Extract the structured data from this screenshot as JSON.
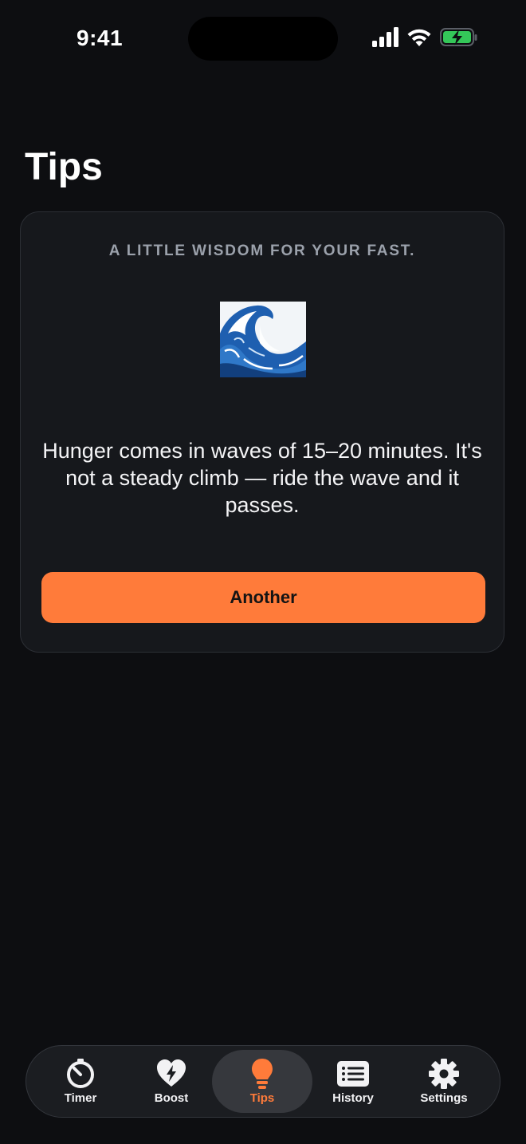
{
  "status_bar": {
    "time": "9:41",
    "icons": [
      "cellular-signal-icon",
      "wifi-icon",
      "battery-charging-icon"
    ],
    "battery_color": "#34c759"
  },
  "page": {
    "title": "Tips"
  },
  "card": {
    "eyebrow": "A LITTLE WISDOM FOR YOUR FAST.",
    "emoji": "wave-emoji",
    "tip": "Hunger comes in waves of 15–20 minutes. It's not a steady climb — ride the wave and it passes.",
    "button_label": "Another"
  },
  "tab_bar": {
    "items": [
      {
        "label": "Timer",
        "icon": "stopwatch-icon",
        "active": false
      },
      {
        "label": "Boost",
        "icon": "heart-bolt-icon",
        "active": false
      },
      {
        "label": "Tips",
        "icon": "lightbulb-icon",
        "active": true
      },
      {
        "label": "History",
        "icon": "list-icon",
        "active": false
      },
      {
        "label": "Settings",
        "icon": "gear-icon",
        "active": false
      }
    ]
  },
  "colors": {
    "accent": "#ff7b3a",
    "background": "#0d0e11",
    "card": "#16181c",
    "muted_text": "#9ba1ab"
  }
}
